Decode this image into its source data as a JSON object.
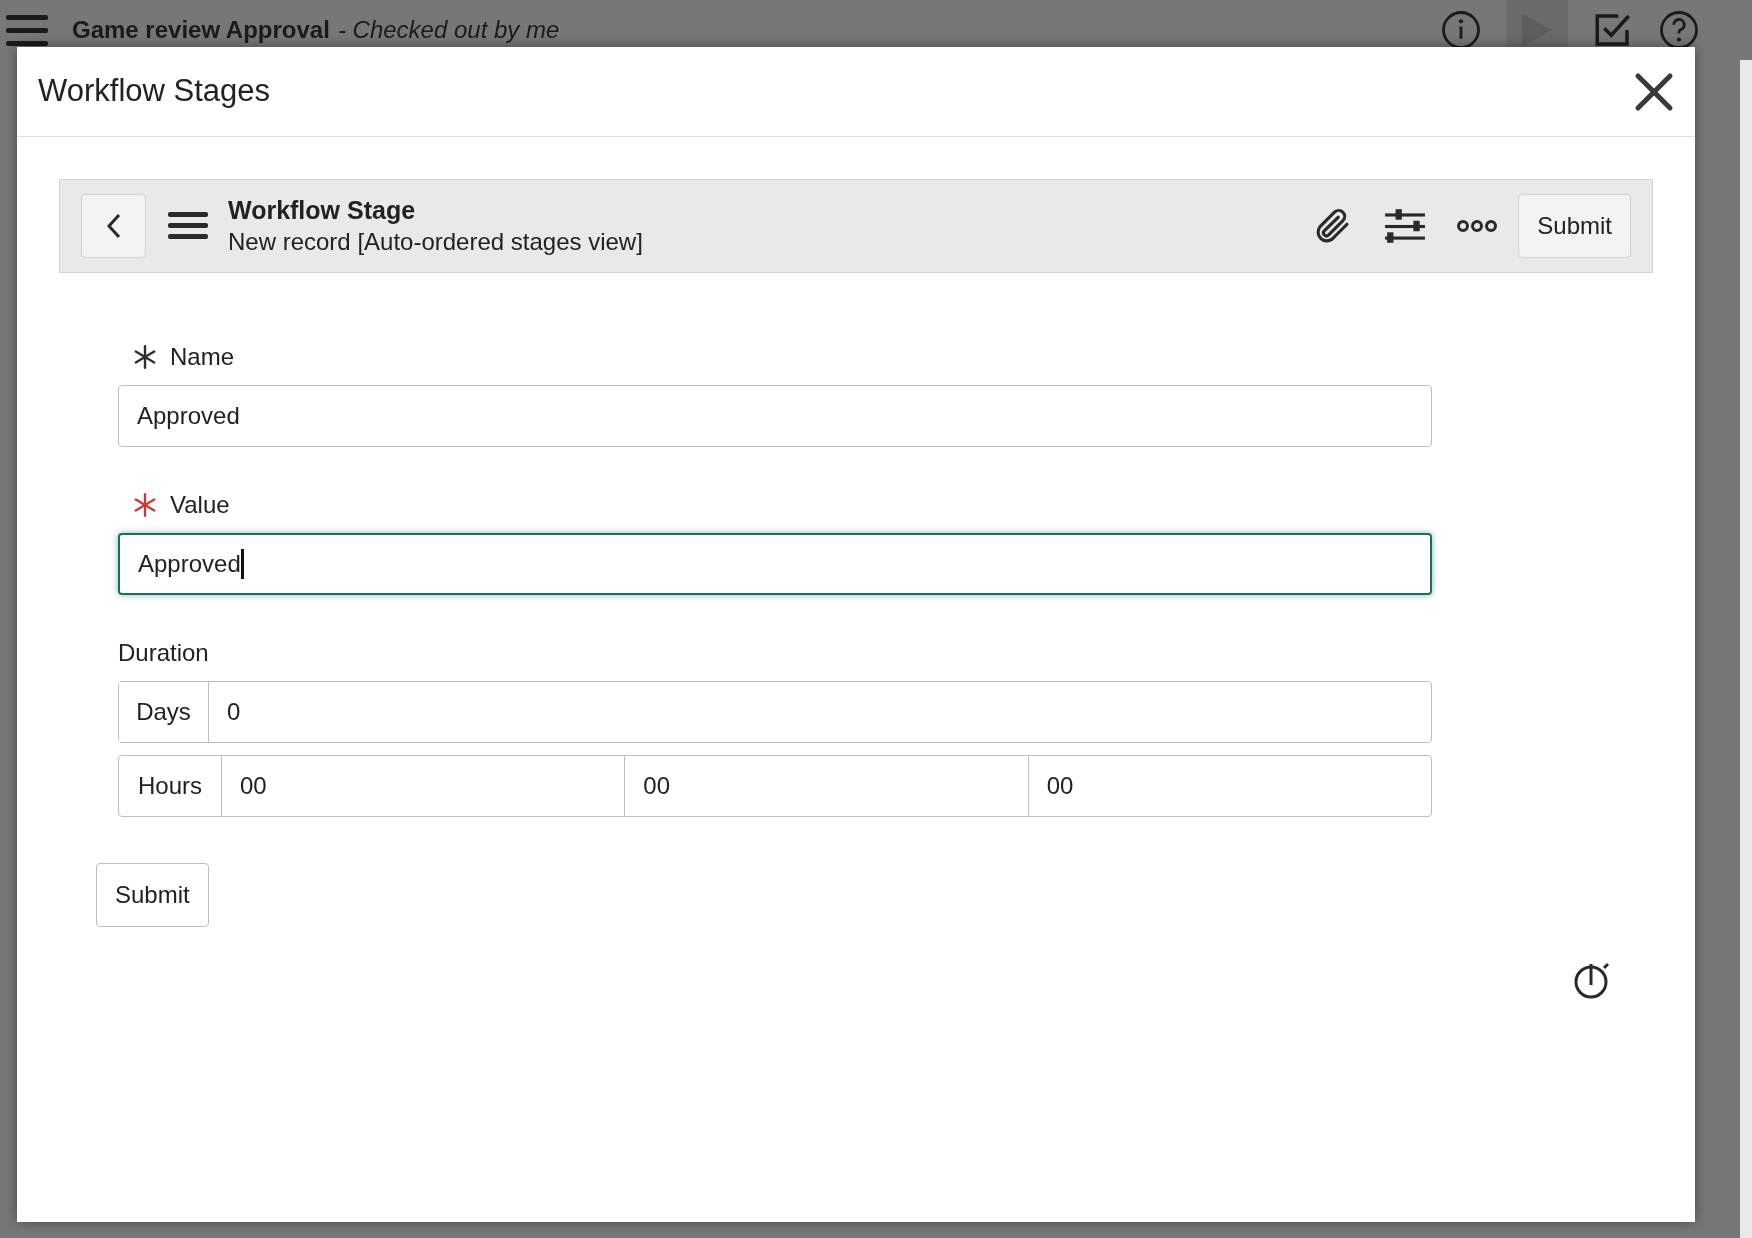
{
  "app_bar": {
    "title": "Game review Approval",
    "subtitle": "- Checked out by me"
  },
  "dialog": {
    "title": "Workflow Stages"
  },
  "form_header": {
    "title": "Workflow Stage",
    "subtitle": "New record [Auto-ordered stages view]",
    "submit": "Submit"
  },
  "fields": [
    {
      "label": "Name",
      "value": "Approved",
      "mandatory_met": true,
      "focused": false
    },
    {
      "label": "Value",
      "value": "Approved",
      "mandatory_met": false,
      "focused": true
    }
  ],
  "duration": {
    "label": "Duration",
    "days_label": "Days",
    "days": "0",
    "hours_label": "Hours",
    "hours": [
      "00",
      "00",
      "00"
    ]
  },
  "submit": "Submit"
}
